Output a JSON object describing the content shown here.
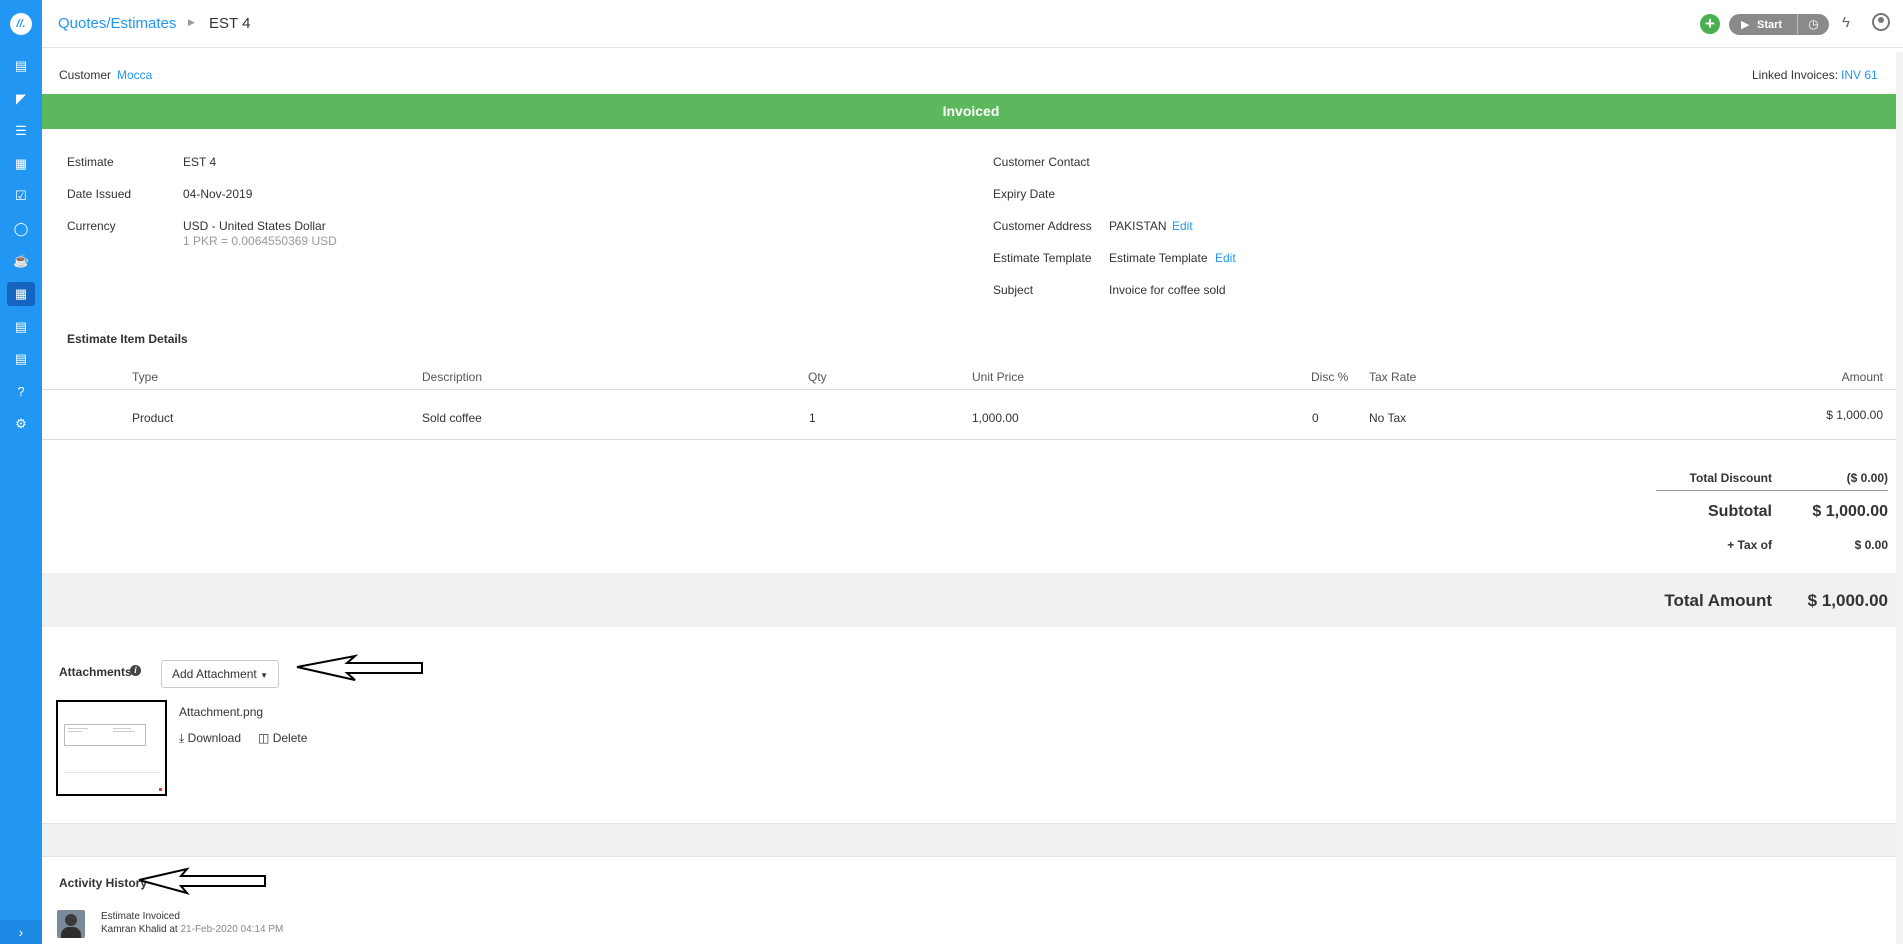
{
  "header": {
    "breadcrumb_root": "Quotes/Estimates",
    "breadcrumb_current": "EST 4",
    "start_label": "Start"
  },
  "sidebar": {
    "items": [
      "document-icon",
      "folder-icon",
      "list-icon",
      "calendar-icon",
      "calendar-check-icon",
      "timer-icon",
      "coffee-icon",
      "estimate-icon",
      "invoice-icon",
      "chart-icon",
      "help-icon",
      "settings-icon"
    ],
    "active": "estimate-icon"
  },
  "customer": {
    "label": "Customer",
    "name": "Mocca",
    "linked_label": "Linked Invoices:",
    "linked_value": "INV 61"
  },
  "status": "Invoiced",
  "details_left": {
    "estimate_label": "Estimate",
    "estimate_value": "EST 4",
    "date_label": "Date Issued",
    "date_value": "04-Nov-2019",
    "currency_label": "Currency",
    "currency_value": "USD - United States Dollar",
    "currency_rate": "1 PKR = 0.0064550369 USD"
  },
  "details_right": {
    "contact_label": "Customer Contact",
    "expiry_label": "Expiry Date",
    "address_label": "Customer Address",
    "address_value": "PAKISTAN",
    "template_label": "Estimate Template",
    "template_value": "Estimate Template",
    "subject_label": "Subject",
    "subject_value": "Invoice for coffee sold",
    "edit_label": "Edit"
  },
  "items": {
    "title": "Estimate Item Details",
    "columns": [
      "Type",
      "Description",
      "Qty",
      "Unit Price",
      "Disc %",
      "Tax Rate",
      "Amount"
    ],
    "rows": [
      [
        "Product",
        "Sold coffee",
        "1",
        "1,000.00",
        "0",
        "No Tax",
        "$ 1,000.00"
      ]
    ]
  },
  "totals": {
    "discount_label": "Total Discount",
    "discount_value": "($ 0.00)",
    "subtotal_label": "Subtotal",
    "subtotal_value": "$ 1,000.00",
    "tax_label": "+ Tax of",
    "tax_value": "$ 0.00",
    "total_label": "Total Amount",
    "total_value": "$ 1,000.00"
  },
  "attachments": {
    "title": "Attachments",
    "add_button": "Add Attachment",
    "file_name": "Attachment.png",
    "download_label": "Download",
    "delete_label": "Delete"
  },
  "history": {
    "title": "Activity History",
    "entries": [
      {
        "event": "Estimate Invoiced",
        "user": "Kamran Khalid",
        "at": "at",
        "time": "21-Feb-2020 04:14 PM"
      }
    ]
  },
  "colors": {
    "brand": "#2196f3",
    "status_green": "#5cb85c",
    "add_green": "#4caf50"
  }
}
